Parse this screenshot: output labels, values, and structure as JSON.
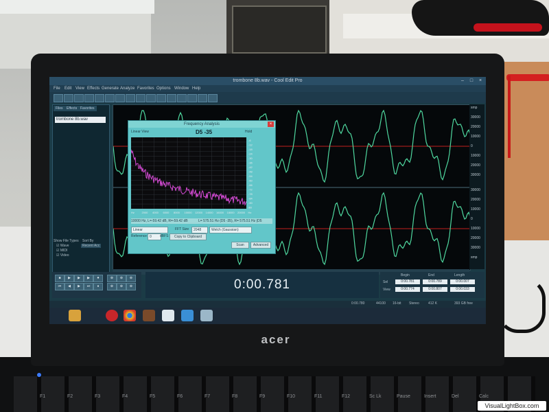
{
  "window": {
    "title": "trombone 8b.wav - Cool Edit Pro",
    "minimize": "–",
    "maximize": "□",
    "close": "×"
  },
  "menu": [
    "File",
    "Edit",
    "View",
    "Effects",
    "Generate",
    "Analyze",
    "Favorites",
    "Options",
    "Window",
    "Help"
  ],
  "side_panel": {
    "tabs": [
      "Files",
      "Effects",
      "Favorites"
    ],
    "file": "trombone 8b.wav",
    "show_file_types": "Show File Types",
    "sort_by": "Sort By",
    "types": [
      "Wave",
      "MIDI",
      "Video"
    ],
    "sort_value": "Recent Acc"
  },
  "waveform": {
    "scale_top": [
      "smp",
      "30000",
      "20000",
      "10000",
      "0",
      "10000",
      "20000",
      "30000"
    ],
    "scale_bottom": [
      "30000",
      "20000",
      "10000",
      "0",
      "10000",
      "20000",
      "30000",
      "smp"
    ],
    "wave_color": "#4fd9a0",
    "center_line_color": "#c21f1f"
  },
  "frequency_analysis": {
    "title": "Frequency Analysis",
    "view_label": "Linear View",
    "note": "D5 -35",
    "hold": "Hold",
    "y_ticks": [
      "-6",
      "-12",
      "-18",
      "-24",
      "-30",
      "-36",
      "-42",
      "-48",
      "-54",
      "-60",
      "-66",
      "-72",
      "-78",
      "-84",
      "-90",
      "dB"
    ],
    "x_ticks": [
      "Hz",
      "2000",
      "4000",
      "6000",
      "8000",
      "10000",
      "12000",
      "14000",
      "16000",
      "18000",
      "20000",
      "Hz"
    ],
    "readout_left": "10000 Hz, L=-59.42 dB, R=-59.42 dB",
    "readout_right": "L= 575.51 Hz (D5 -35), R= 575.51 Hz (D5",
    "scale_type": "Linear",
    "fft_size_label": "FFT Size",
    "fft_size": "2048",
    "window_type": "Welch (Gaussian)",
    "reference_label": "Reference",
    "reference_value": "0",
    "dbfs": "dBFS",
    "copy_button": "Copy to Clipboard",
    "scan_button": "Scan",
    "advanced_button": "Advanced",
    "curve_color": "#d64bd6"
  },
  "time_display": "0:00.781",
  "selection": {
    "headers": [
      "Begin",
      "End",
      "Length"
    ],
    "sel_label": "Sel",
    "view_label": "View",
    "sel": [
      "0:00.781",
      "0:00.789",
      "0:00.007"
    ],
    "view": [
      "0:00.774",
      "0:00.807",
      "0:00.033"
    ]
  },
  "status": [
    "0:00.780",
    "44100",
    "16-bit",
    "Stereo",
    "412 K",
    "393 GB free"
  ],
  "taskbar_icons": [
    "folder-icon",
    "power-icon",
    "chrome-icon",
    "cool-edit-icon",
    "media-icon",
    "app-icon",
    "explorer-icon"
  ],
  "laptop": {
    "brand": "acer",
    "keys": [
      "F1",
      "F2",
      "F3",
      "F4",
      "F5",
      "F6",
      "F7",
      "F8",
      "F9",
      "F10",
      "F11",
      "F12",
      "Sc Lk",
      "Pause",
      "Insert",
      "Del",
      "Calc"
    ]
  },
  "watermark": "VisualLightBox.com"
}
